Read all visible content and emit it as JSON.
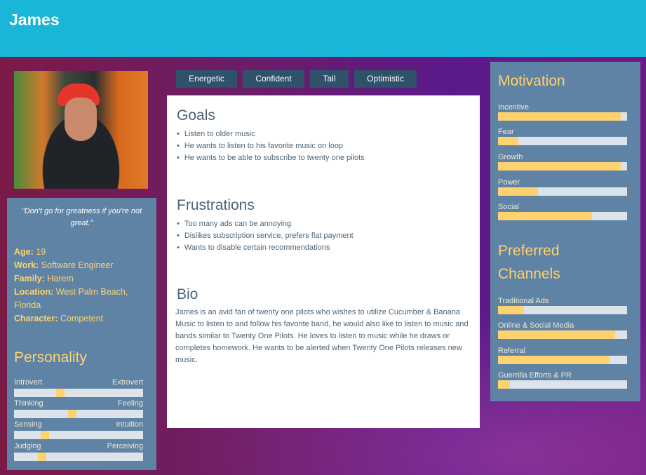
{
  "header": {
    "name": "James"
  },
  "profile": {
    "quote": "\"Don't go for greatness if you're not great.\"",
    "facts": [
      {
        "label": "Age:",
        "value": "19"
      },
      {
        "label": "Work:",
        "value": "Software Engineer"
      },
      {
        "label": "Family:",
        "value": "Harem"
      },
      {
        "label": "Location:",
        "value": "West Palm Beach, Florida"
      },
      {
        "label": "Character:",
        "value": "Competent"
      }
    ]
  },
  "personality": {
    "title": "Personality",
    "scales": [
      {
        "left": "Introvert",
        "right": "Extrovert",
        "level": 0.35
      },
      {
        "left": "Thinking",
        "right": "Feeling",
        "level": 0.45
      },
      {
        "left": "Sensing",
        "right": "Intuition",
        "level": 0.22
      },
      {
        "left": "Judging",
        "right": "Perceiving",
        "level": 0.2
      }
    ]
  },
  "tags": [
    "Energetic",
    "Confident",
    "Tall",
    "Optimistic"
  ],
  "goals": {
    "title": "Goals",
    "items": [
      "Listen to older music",
      "He wants to listen to his favorite music on loop",
      "He wants to be able to subscribe to twenty one pilots"
    ]
  },
  "frustrations": {
    "title": "Frustrations",
    "items": [
      "Too many ads can be annoying",
      "Dislikes subscription service, prefers flat payment",
      "Wants to disable certain recommendations"
    ]
  },
  "bio": {
    "title": "Bio",
    "text": "James is an avid fan of twenty one pilots who wishes to utilize Cucumber & Banana Music to listen to and follow his favorite band, he would also like to listen to music and bands similar to Twenty One Pilots. He loves to listen to music while he draws or completes homework. He wants to be alerted when Twenty One Pilots releases new music."
  },
  "motivation": {
    "title": "Motivation",
    "bars": [
      {
        "label": "Incentive",
        "level": 0.95
      },
      {
        "label": "Fear",
        "level": 0.16
      },
      {
        "label": "Growth",
        "level": 0.95
      },
      {
        "label": "Power",
        "level": 0.31
      },
      {
        "label": "Social",
        "level": 0.73
      }
    ]
  },
  "channels": {
    "title": "Preferred Channels",
    "bars": [
      {
        "label": "Traditional Ads",
        "level": 0.2
      },
      {
        "label": "Online & Social Media",
        "level": 0.91
      },
      {
        "label": "Referral",
        "level": 0.86
      },
      {
        "label": "Guerrilla Efforts & PR",
        "level": 0.09
      }
    ]
  },
  "colors": {
    "header": "#19b6d8",
    "panel": "#5e83a4",
    "accent": "#ffd270",
    "tag": "#2f516a"
  }
}
